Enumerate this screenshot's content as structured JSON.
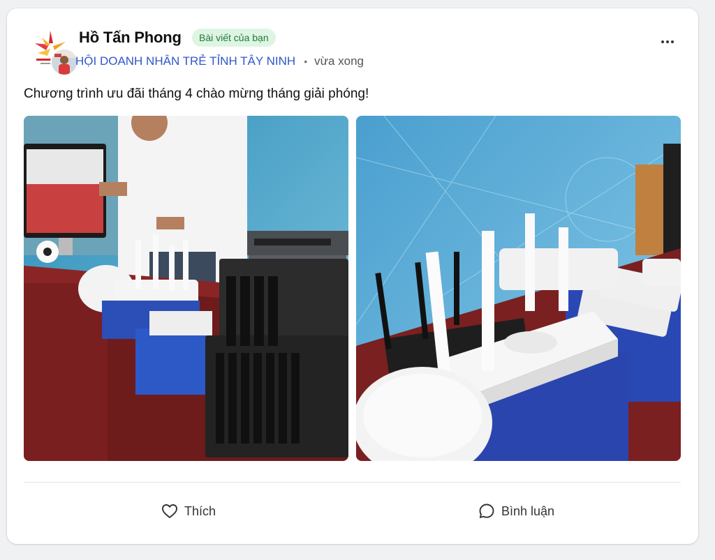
{
  "post": {
    "author_name": "Hồ Tấn Phong",
    "own_badge": "Bài viết của bạn",
    "group_name": "HỘI DOANH NHÂN TRẺ TỈNH TÂY NINH",
    "meta_separator": "•",
    "time": "vừa xong",
    "caption": "Chương trình ưu đãi tháng 4 chào mừng tháng giải phóng!",
    "more_icon": "more-horizontal-icon"
  },
  "images": [
    {
      "name": "post-photo-1",
      "subject": "Network devices exhibition table with man"
    },
    {
      "name": "post-photo-2",
      "subject": "WiFi routers on display table"
    }
  ],
  "actions": {
    "like_label": "Thích",
    "comment_label": "Bình luận",
    "like_icon": "heart-icon",
    "comment_icon": "comment-bubble-icon"
  },
  "colors": {
    "group_link": "#3057c7",
    "badge_bg": "#dff5e3",
    "badge_text": "#1f7a35",
    "card_bg": "#ffffff",
    "page_bg": "#f0f1f3"
  }
}
